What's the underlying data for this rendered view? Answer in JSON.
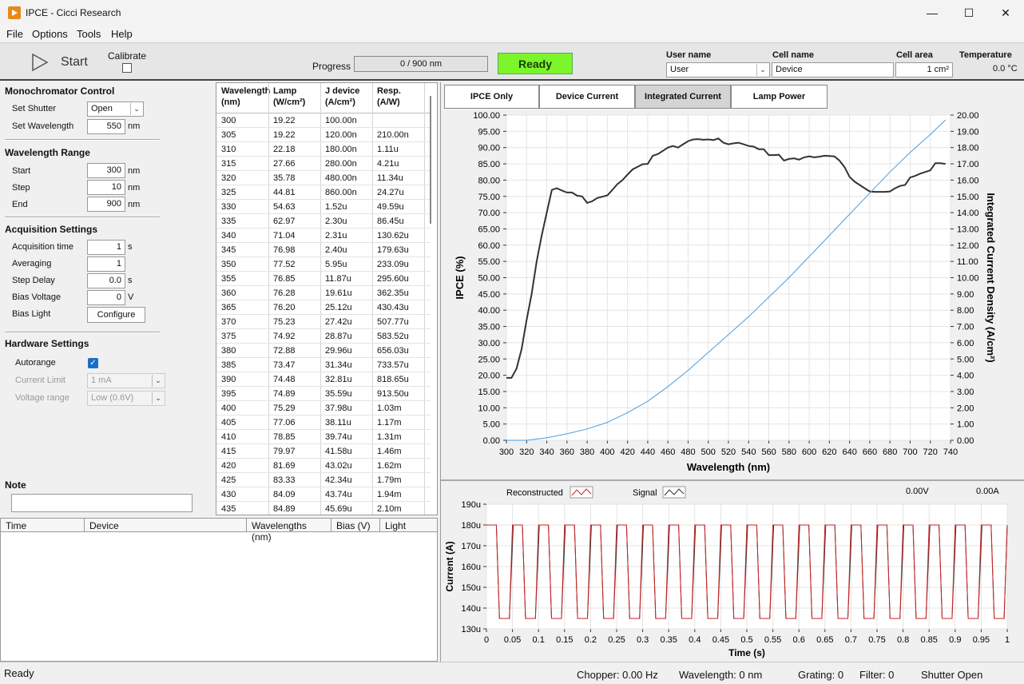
{
  "window": {
    "title": "IPCE - Cicci Research"
  },
  "menu": [
    "File",
    "Options",
    "Tools",
    "Help"
  ],
  "toolbar": {
    "start_label": "Start",
    "calibrate_label": "Calibrate",
    "calibrate_checked": false,
    "progress_label": "Progress",
    "progress_text": "0 / 900 nm",
    "progress_fraction": 0,
    "status_label": "Ready",
    "status_color": "#7cf52a",
    "user_name_label": "User name",
    "user_name_value": "User",
    "cell_name_label": "Cell name",
    "cell_name_value": "Device",
    "cell_area_label": "Cell area",
    "cell_area_value": "1 cm²",
    "temperature_label": "Temperature",
    "temperature_value": "0.0 °C"
  },
  "mono": {
    "title": "Monochromator Control",
    "shutter_label": "Set Shutter",
    "shutter_value": "Open",
    "wavelength_label": "Set Wavelength",
    "wavelength_value": "550",
    "wavelength_unit": "nm"
  },
  "range": {
    "title": "Wavelength Range",
    "start_label": "Start",
    "start_value": "300",
    "step_label": "Step",
    "step_value": "10",
    "end_label": "End",
    "end_value": "900",
    "unit": "nm"
  },
  "acq": {
    "title": "Acquisition Settings",
    "time_label": "Acquisition time",
    "time_value": "1",
    "time_unit": "s",
    "avg_label": "Averaging",
    "avg_value": "1",
    "delay_label": "Step Delay",
    "delay_value": "0.0",
    "delay_unit": "s",
    "bias_label": "Bias Voltage",
    "bias_value": "0",
    "bias_unit": "V",
    "light_label": "Bias Light",
    "configure_label": "Configure"
  },
  "hw": {
    "title": "Hardware Settings",
    "autorange_label": "Autorange",
    "autorange_checked": true,
    "current_limit_label": "Current Limit",
    "current_limit_value": "1 mA",
    "voltage_range_label": "Voltage range",
    "voltage_range_value": "Low (0.6V)"
  },
  "note": {
    "label": "Note",
    "value": ""
  },
  "table": {
    "headers": [
      [
        "Wavelength",
        "(nm)"
      ],
      [
        "Lamp",
        "(W/cm²)"
      ],
      [
        "J device",
        "(A/cm²)"
      ],
      [
        "Resp.",
        "(A/W)"
      ]
    ],
    "rows": [
      [
        "300",
        "19.22",
        "100.00n",
        ""
      ],
      [
        "305",
        "19.22",
        "120.00n",
        "210.00n"
      ],
      [
        "310",
        "22.18",
        "180.00n",
        "1.11u"
      ],
      [
        "315",
        "27.66",
        "280.00n",
        "4.21u"
      ],
      [
        "320",
        "35.78",
        "480.00n",
        "11.34u"
      ],
      [
        "325",
        "44.81",
        "860.00n",
        "24.27u"
      ],
      [
        "330",
        "54.63",
        "1.52u",
        "49.59u"
      ],
      [
        "335",
        "62.97",
        "2.30u",
        "86.45u"
      ],
      [
        "340",
        "71.04",
        "2.31u",
        "130.62u"
      ],
      [
        "345",
        "76.98",
        "2.40u",
        "179.63u"
      ],
      [
        "350",
        "77.52",
        "5.95u",
        "233.09u"
      ],
      [
        "355",
        "76.85",
        "11.87u",
        "295.60u"
      ],
      [
        "360",
        "76.28",
        "19.61u",
        "362.35u"
      ],
      [
        "365",
        "76.20",
        "25.12u",
        "430.43u"
      ],
      [
        "370",
        "75.23",
        "27.42u",
        "507.77u"
      ],
      [
        "375",
        "74.92",
        "28.87u",
        "583.52u"
      ],
      [
        "380",
        "72.88",
        "29.96u",
        "656.03u"
      ],
      [
        "385",
        "73.47",
        "31.34u",
        "733.57u"
      ],
      [
        "390",
        "74.48",
        "32.81u",
        "818.65u"
      ],
      [
        "395",
        "74.89",
        "35.59u",
        "913.50u"
      ],
      [
        "400",
        "75.29",
        "37.98u",
        "1.03m"
      ],
      [
        "405",
        "77.06",
        "38.11u",
        "1.17m"
      ],
      [
        "410",
        "78.85",
        "39.74u",
        "1.31m"
      ],
      [
        "415",
        "79.97",
        "41.58u",
        "1.46m"
      ],
      [
        "420",
        "81.69",
        "43.02u",
        "1.62m"
      ],
      [
        "425",
        "83.33",
        "42.34u",
        "1.79m"
      ],
      [
        "430",
        "84.09",
        "43.74u",
        "1.94m"
      ],
      [
        "435",
        "84.89",
        "45.69u",
        "2.10m"
      ]
    ]
  },
  "log": {
    "headers": [
      "Time",
      "Device",
      "Wavelengths (nm)",
      "Bias (V)",
      "Light"
    ]
  },
  "tabs": [
    "IPCE Only",
    "Device Current",
    "Integrated Current",
    "Lamp Power"
  ],
  "active_tab": 2,
  "scope": {
    "legend_reconstructed": "Reconstructed",
    "legend_signal": "Signal",
    "voltage_readout": "0.00V",
    "current_readout": "0.00A"
  },
  "chart_data": [
    {
      "type": "line",
      "xlabel": "Wavelength (nm)",
      "ylabel": "IPCE (%)",
      "y2label": "Integrated Current Density (A/cm²)",
      "xlim": [
        300,
        740
      ],
      "ylim": [
        0,
        100
      ],
      "y2lim": [
        0,
        20
      ],
      "xticks": [
        300,
        320,
        340,
        360,
        380,
        400,
        420,
        440,
        460,
        480,
        500,
        520,
        540,
        560,
        580,
        600,
        620,
        640,
        660,
        680,
        700,
        720,
        740
      ],
      "yticks": [
        "0.00",
        "5.00",
        "10.00",
        "15.00",
        "20.00",
        "25.00",
        "30.00",
        "35.00",
        "40.00",
        "45.00",
        "50.00",
        "55.00",
        "60.00",
        "65.00",
        "70.00",
        "75.00",
        "80.00",
        "85.00",
        "90.00",
        "95.00",
        "100.00"
      ],
      "y2ticks": [
        "0.00",
        "1.00",
        "2.00",
        "3.00",
        "4.00",
        "5.00",
        "6.00",
        "7.00",
        "8.00",
        "9.00",
        "10.00",
        "11.00",
        "12.00",
        "13.00",
        "14.00",
        "15.00",
        "16.00",
        "17.00",
        "18.00",
        "19.00",
        "20.00"
      ],
      "grid": true,
      "series": [
        {
          "color": "#333333",
          "axis": "left",
          "x": [
            300,
            305,
            310,
            315,
            320,
            325,
            330,
            335,
            340,
            345,
            350,
            355,
            360,
            365,
            370,
            375,
            380,
            385,
            390,
            395,
            400,
            405,
            410,
            415,
            420,
            425,
            430,
            435,
            440,
            445,
            450,
            455,
            460,
            465,
            470,
            475,
            480,
            485,
            490,
            495,
            500,
            505,
            510,
            515,
            520,
            525,
            530,
            535,
            540,
            545,
            550,
            555,
            560,
            565,
            570,
            575,
            580,
            585,
            590,
            595,
            600,
            605,
            610,
            615,
            620,
            625,
            630,
            635,
            640,
            645,
            650,
            655,
            660,
            665,
            670,
            675,
            680,
            685,
            690,
            695,
            700,
            705,
            710,
            715,
            720,
            725,
            730,
            735
          ],
          "y": [
            19.2,
            19.2,
            22,
            28,
            37,
            45,
            55,
            63,
            70,
            77,
            77.5,
            76.8,
            76.2,
            76.2,
            75.2,
            75,
            73,
            73.5,
            74.5,
            74.9,
            75.3,
            77,
            78.8,
            80,
            81.7,
            83.3,
            84.1,
            84.9,
            85,
            87.5,
            88,
            89,
            90,
            90.5,
            90,
            91,
            92,
            92.5,
            92.6,
            92.4,
            92.5,
            92.3,
            92.8,
            91.5,
            91,
            91.3,
            91.5,
            91,
            90.5,
            90.3,
            89.5,
            89.5,
            87.7,
            87.7,
            87.8,
            86,
            86.5,
            86.7,
            86.3,
            87,
            87.3,
            87,
            87.2,
            87.5,
            87.4,
            87.3,
            86,
            84,
            81,
            79.5,
            78.5,
            77.5,
            76.5,
            76.4,
            76.4,
            76.4,
            76.5,
            77.5,
            78.2,
            78.5,
            80.8,
            81.3,
            82,
            82.5,
            83,
            85.2,
            85.2,
            85
          ]
        },
        {
          "color": "#4a9ee0",
          "axis": "right",
          "x": [
            300,
            320,
            340,
            360,
            380,
            400,
            420,
            440,
            460,
            480,
            500,
            520,
            540,
            560,
            580,
            600,
            620,
            640,
            660,
            680,
            700,
            720,
            735
          ],
          "y": [
            0,
            0,
            0.15,
            0.4,
            0.7,
            1.1,
            1.7,
            2.4,
            3.3,
            4.3,
            5.4,
            6.5,
            7.6,
            8.8,
            10,
            11.3,
            12.6,
            13.9,
            15.2,
            16.5,
            17.7,
            18.8,
            19.7
          ]
        }
      ]
    },
    {
      "type": "line",
      "xlabel": "Time (s)",
      "ylabel": "Current (A)",
      "xlim": [
        0,
        1
      ],
      "ylim": [
        130,
        190
      ],
      "xticks": [
        "0",
        "0.05",
        "0.1",
        "0.15",
        "0.2",
        "0.25",
        "0.3",
        "0.35",
        "0.4",
        "0.45",
        "0.5",
        "0.55",
        "0.6",
        "0.65",
        "0.7",
        "0.75",
        "0.8",
        "0.85",
        "0.9",
        "0.95",
        "1"
      ],
      "yticks": [
        "130u",
        "140u",
        "150u",
        "160u",
        "170u",
        "180u",
        "190u"
      ],
      "grid": true,
      "series": [
        {
          "name": "Reconstructed",
          "color": "#cc2222",
          "period": 0.05,
          "high": 180,
          "low": 135
        },
        {
          "name": "Signal",
          "color": "#333333",
          "period": 0.05,
          "high": 180,
          "low": 135
        }
      ]
    }
  ],
  "statusbar": {
    "status": "Ready",
    "chopper": "Chopper: 0.00 Hz",
    "wavelength": "Wavelength: 0 nm",
    "grating": "Grating: 0",
    "filter": "Filter: 0",
    "shutter": "Shutter Open"
  }
}
